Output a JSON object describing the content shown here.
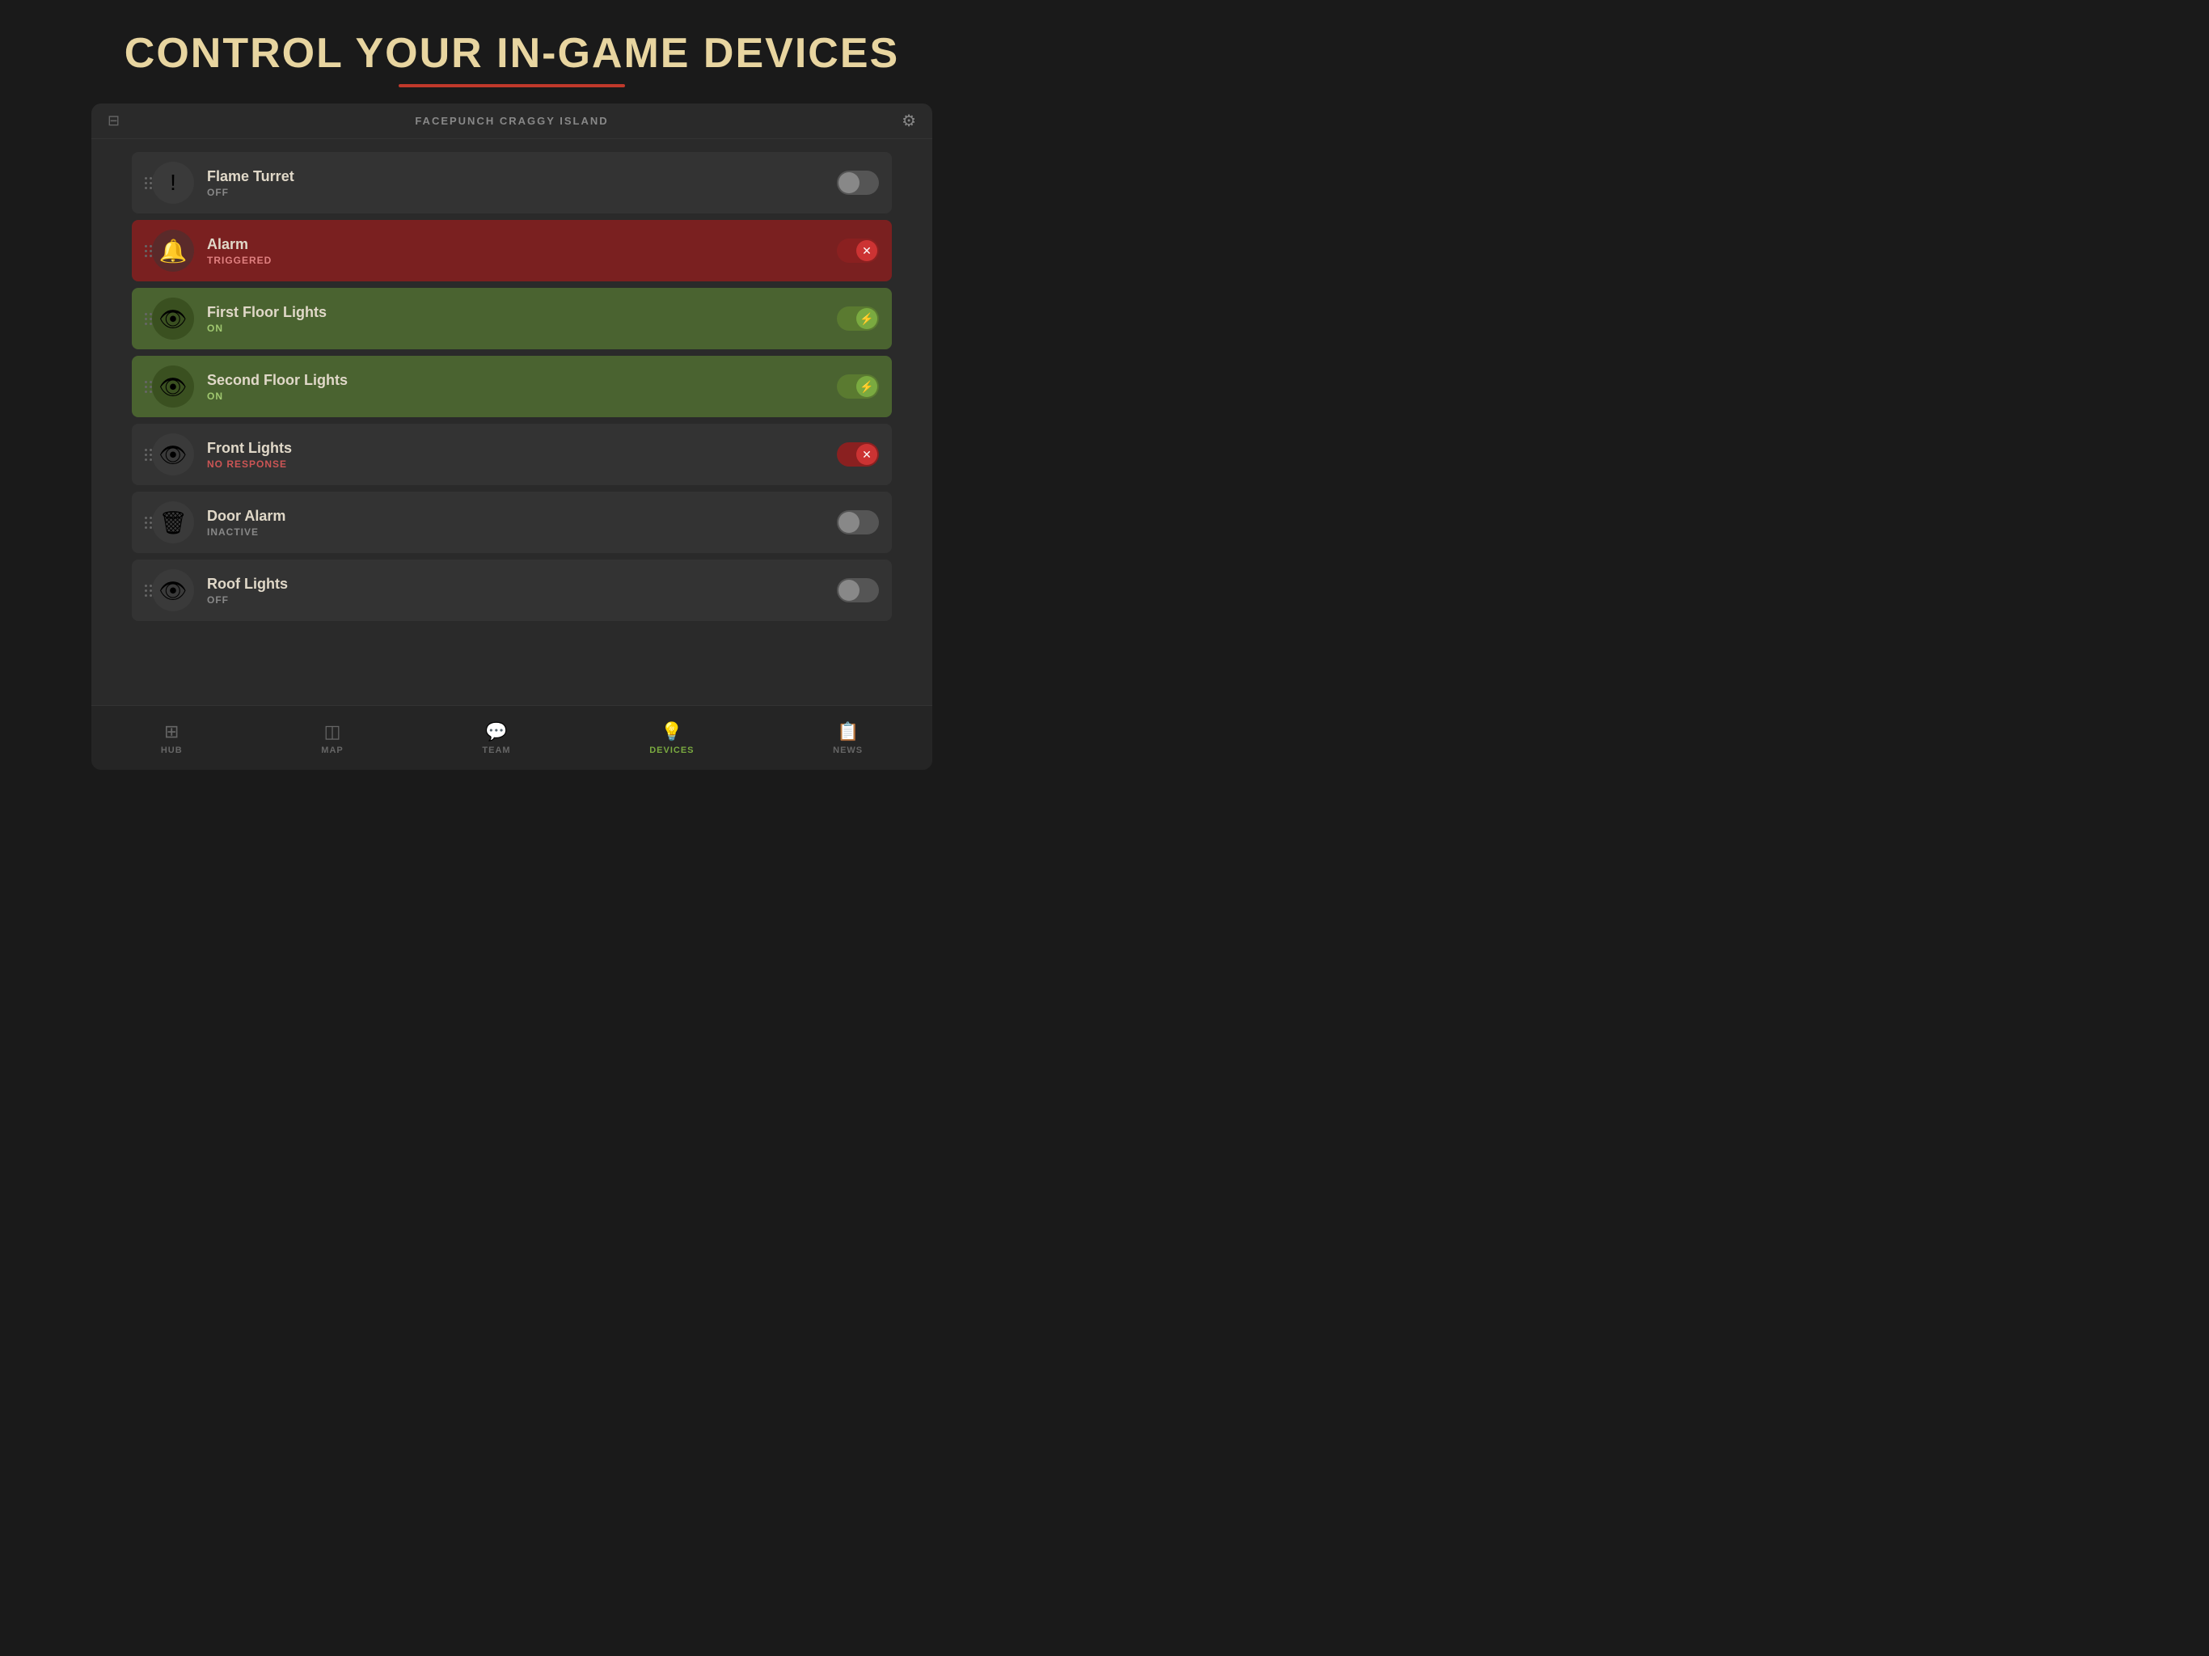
{
  "page": {
    "title": "CONTROL YOUR IN-GAME DEVICES"
  },
  "panel": {
    "server_name": "FACEPUNCH CRAGGY ISLAND"
  },
  "devices": [
    {
      "id": "flame-turret",
      "name": "Flame Turret",
      "status": "OFF",
      "status_class": "off",
      "row_class": "off",
      "toggle_class": "off-toggle",
      "icon": "🔫"
    },
    {
      "id": "alarm",
      "name": "Alarm",
      "status": "TRIGGERED",
      "status_class": "triggered",
      "row_class": "triggered",
      "toggle_class": "error-toggle",
      "icon": "🔔"
    },
    {
      "id": "first-floor-lights",
      "name": "First Floor Lights",
      "status": "ON",
      "status_class": "on",
      "row_class": "on",
      "toggle_class": "on-toggle",
      "icon": "💡"
    },
    {
      "id": "second-floor-lights",
      "name": "Second Floor Lights",
      "status": "ON",
      "status_class": "on",
      "row_class": "on",
      "toggle_class": "on-toggle",
      "icon": "💡"
    },
    {
      "id": "front-lights",
      "name": "Front Lights",
      "status": "NO RESPONSE",
      "status_class": "no-response",
      "row_class": "no-response",
      "toggle_class": "error-toggle",
      "icon": "💡"
    },
    {
      "id": "door-alarm",
      "name": "Door Alarm",
      "status": "INACTIVE",
      "status_class": "inactive",
      "row_class": "inactive",
      "toggle_class": "off-toggle",
      "icon": "🚪"
    },
    {
      "id": "roof-lights",
      "name": "Roof Lights",
      "status": "OFF",
      "status_class": "off",
      "row_class": "off",
      "toggle_class": "off-toggle",
      "icon": "💡"
    }
  ],
  "nav": {
    "items": [
      {
        "id": "hub",
        "label": "HUB",
        "icon": "⊞",
        "active": false
      },
      {
        "id": "map",
        "label": "MAP",
        "icon": "◫",
        "active": false
      },
      {
        "id": "team",
        "label": "TEAM",
        "icon": "💬",
        "active": false
      },
      {
        "id": "devices",
        "label": "DEVICES",
        "icon": "💡",
        "active": true
      },
      {
        "id": "news",
        "label": "NEWS",
        "icon": "📋",
        "active": false
      }
    ]
  }
}
